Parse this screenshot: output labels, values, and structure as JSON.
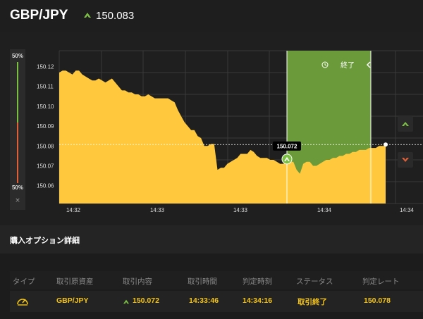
{
  "header": {
    "pair": "GBP/JPY",
    "direction_icon": "up-arrow-icon",
    "rate": "150.083"
  },
  "gauge": {
    "top_percent": "50%",
    "bottom_percent": "50%",
    "close_symbol": "×"
  },
  "chart_data": {
    "type": "area",
    "y_ticks": [
      "150.12",
      "150.11",
      "150.10",
      "150.09",
      "150.08",
      "150.07",
      "150.06"
    ],
    "x_ticks": [
      "14:32",
      "14:33",
      "14:33",
      "14:34",
      "14:34"
    ],
    "ylim": [
      150.051,
      150.128
    ],
    "series": [
      {
        "values": [
          150.117,
          150.118,
          150.118,
          150.117,
          150.116,
          150.118,
          150.118,
          150.116,
          150.115,
          150.114,
          150.113,
          150.113,
          150.114,
          150.113,
          150.112,
          150.113,
          150.114,
          150.112,
          150.11,
          150.108,
          150.108,
          150.107,
          150.107,
          150.106,
          150.106,
          150.105,
          150.105,
          150.106,
          150.105,
          150.104,
          150.104,
          150.104,
          150.104,
          150.104,
          150.103,
          150.102,
          150.098,
          150.095,
          150.092,
          150.09,
          150.088,
          150.088,
          150.085,
          150.084,
          150.08,
          150.08,
          150.081,
          150.081,
          150.068,
          150.069,
          150.069,
          150.071,
          150.072,
          150.073,
          150.074,
          150.076,
          150.076,
          150.076,
          150.078,
          150.077,
          150.075,
          150.074,
          150.074,
          150.074,
          150.073,
          150.073,
          150.072,
          150.071,
          150.071,
          150.072,
          150.072,
          150.072,
          150.068,
          150.066,
          150.071,
          150.072,
          150.072,
          150.07,
          150.07,
          150.071,
          150.072,
          150.073,
          150.073,
          150.074,
          150.074,
          150.075,
          150.075,
          150.076,
          150.076,
          150.077,
          150.077,
          150.078,
          150.078,
          150.078,
          150.079,
          150.079,
          150.079,
          150.08,
          150.08,
          150.08
        ]
      }
    ],
    "current_rate": "150.078",
    "strike": {
      "label": "150.072",
      "value": 150.072
    },
    "end_label": "終了"
  },
  "section_title": "購入オプション詳細",
  "table": {
    "headers": [
      "タイプ",
      "取引原資産",
      "取引内容",
      "取引時間",
      "判定時刻",
      "ステータス",
      "判定レート"
    ],
    "row": {
      "type_icon": "gauge-icon",
      "asset": "GBP/JPY",
      "direction_icon": "up-arrow-icon",
      "content": "150.072",
      "trade_time": "14:33:46",
      "judge_time": "14:34:16",
      "status": "取引終了",
      "judge_rate": "150.078"
    }
  },
  "colors": {
    "up": "#7bc043",
    "down": "#e0603a",
    "area": "#ffc83d",
    "highlight": "#6b9a3a",
    "text_accent": "#f5c518"
  }
}
